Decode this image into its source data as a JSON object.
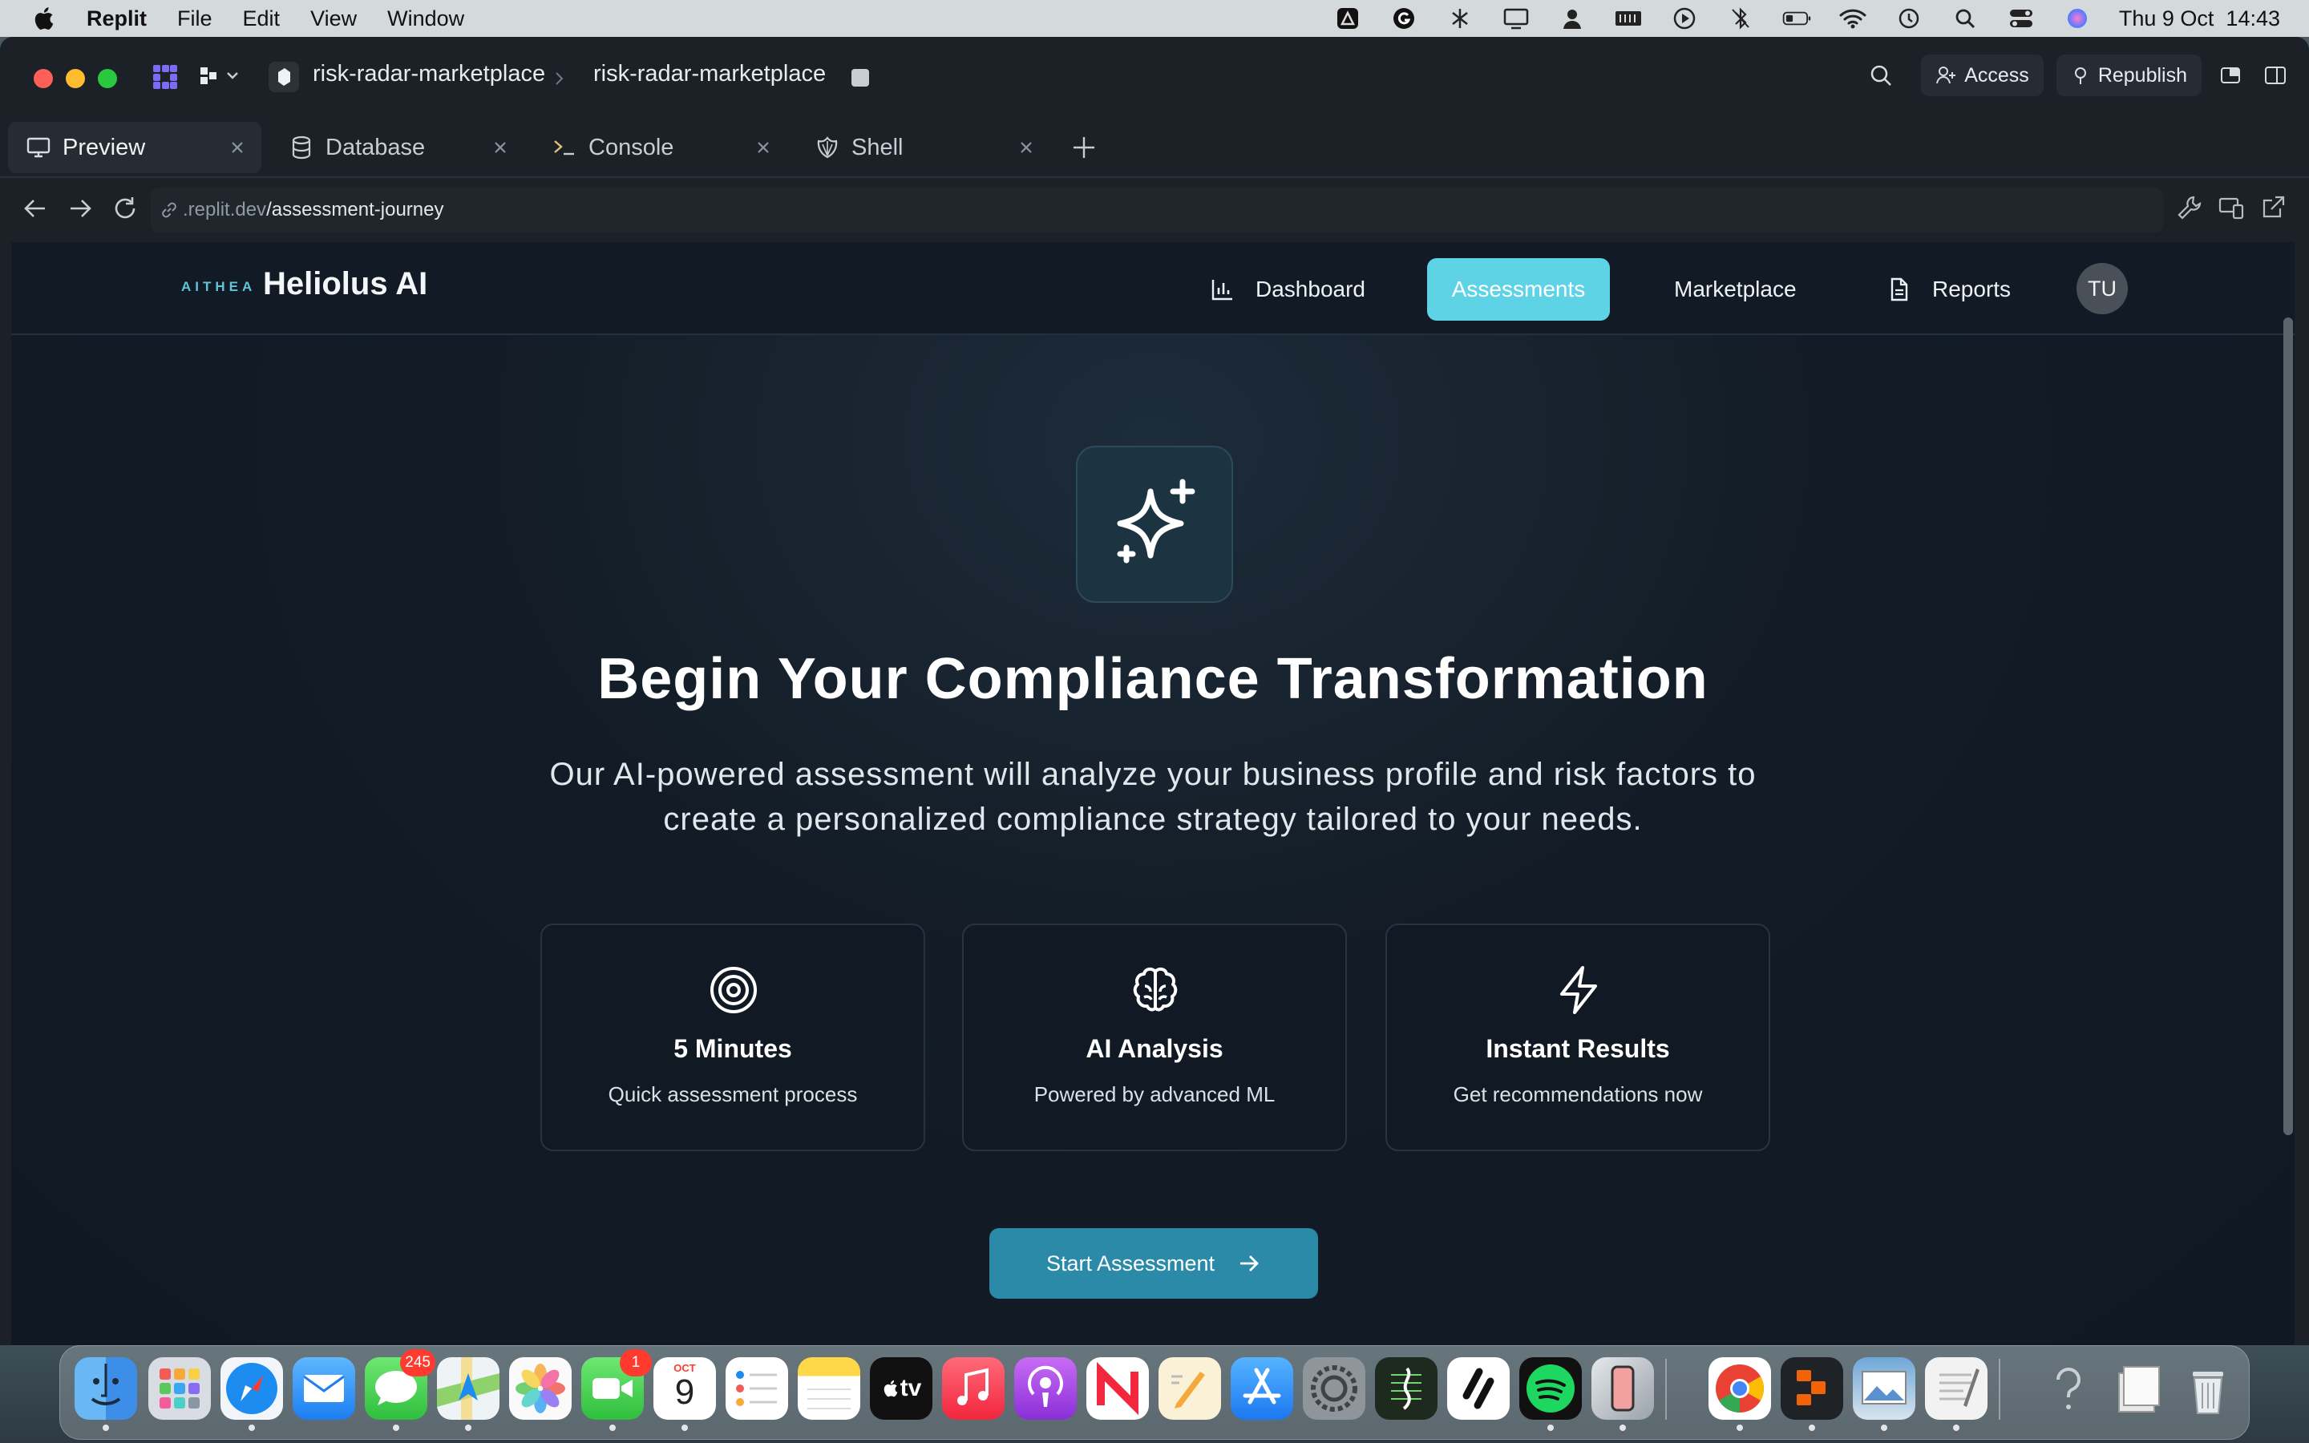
{
  "menubar": {
    "app_name": "Replit",
    "items": [
      "File",
      "Edit",
      "View",
      "Window"
    ],
    "datetime": "Thu 9 Oct  14:43"
  },
  "titlebar": {
    "project": "risk-radar-marketplace",
    "project2": "risk-radar-marketplace",
    "access_label": "Access",
    "republish_label": "Republish"
  },
  "tabs": [
    {
      "label": "Preview",
      "icon": "monitor-icon",
      "active": true
    },
    {
      "label": "Database",
      "icon": "database-icon",
      "active": false
    },
    {
      "label": "Console",
      "icon": "terminal-icon",
      "active": false
    },
    {
      "label": "Shell",
      "icon": "shell-icon",
      "active": false
    }
  ],
  "url": {
    "domain": ".replit.dev",
    "path": "/assessment-journey"
  },
  "site": {
    "logo_mark": "AITHEA",
    "logo_text": "Heliolus AI",
    "nav": {
      "dashboard": "Dashboard",
      "assessments": "Assessments",
      "marketplace": "Marketplace",
      "reports": "Reports"
    },
    "avatar_initials": "TU",
    "accent_color": "#5fd3e6",
    "button_color": "#2a8aa8"
  },
  "hero": {
    "title": "Begin Your Compliance Transformation",
    "description": "Our AI-powered assessment will analyze your business profile and risk factors to create a personalized compliance strategy tailored to your needs."
  },
  "features": [
    {
      "icon": "target-icon",
      "title": "5 Minutes",
      "desc": "Quick assessment process"
    },
    {
      "icon": "brain-icon",
      "title": "AI Analysis",
      "desc": "Powered by advanced ML"
    },
    {
      "icon": "lightning-icon",
      "title": "Instant Results",
      "desc": "Get recommendations now"
    }
  ],
  "cta": {
    "label": "Start Assessment"
  },
  "dock": {
    "messages_badge": "245",
    "facetime_badge": "1",
    "calendar_month": "OCT",
    "calendar_day": "9",
    "appletv_label": "tv"
  }
}
